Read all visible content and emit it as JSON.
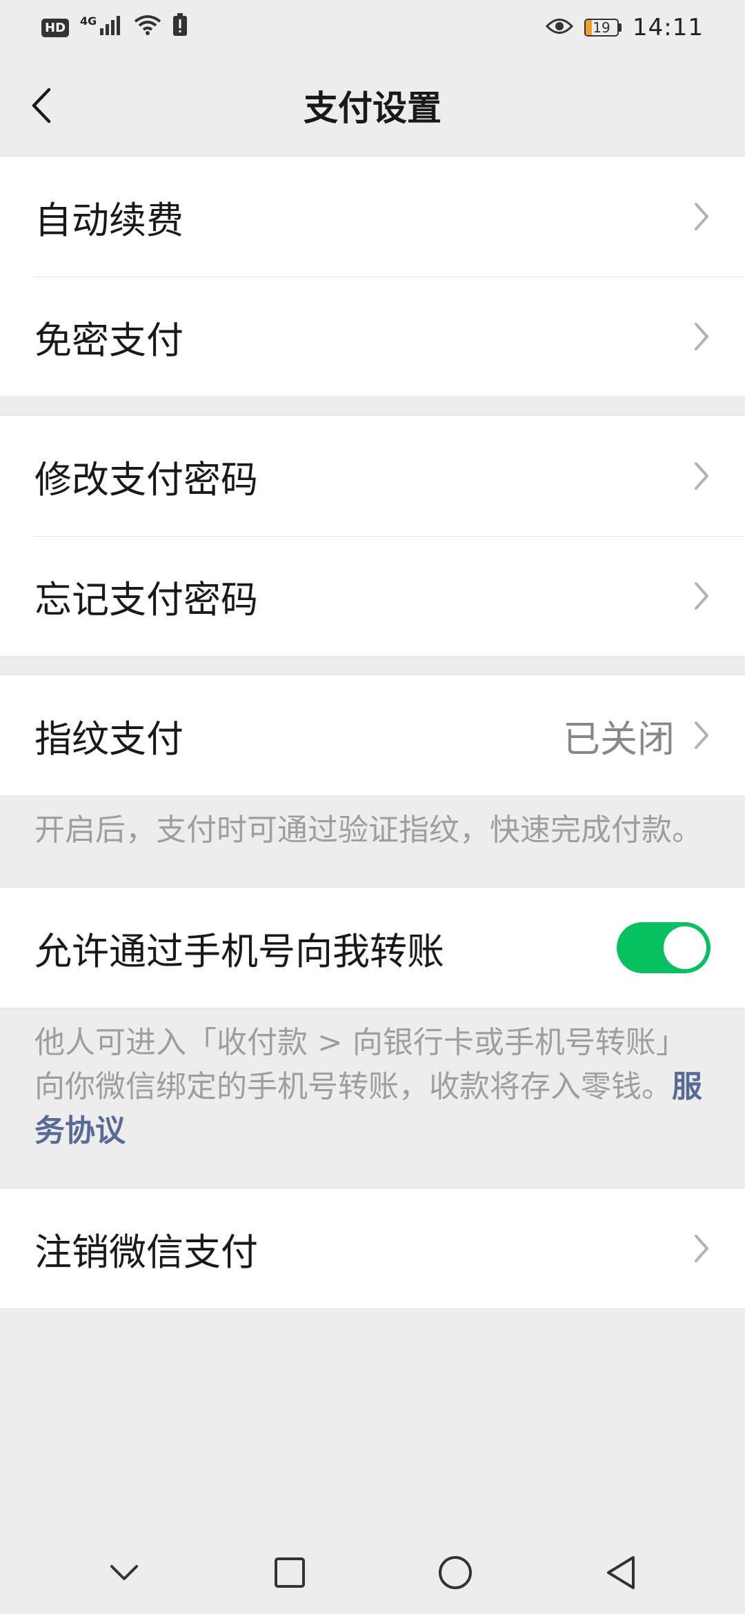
{
  "status_bar": {
    "hd": "HD",
    "network": "4G",
    "battery_level": "19",
    "battery_fraction": 0.19,
    "time": "14:11",
    "battery_color": "#f0a030"
  },
  "nav": {
    "title": "支付设置",
    "back_icon": "chevron-left-icon"
  },
  "groups": {
    "group1": {
      "auto_renew": "自动续费",
      "password_free": "免密支付"
    },
    "group2": {
      "change_password": "修改支付密码",
      "forgot_password": "忘记支付密码"
    },
    "group3": {
      "fingerprint": "指纹支付",
      "fingerprint_value": "已关闭",
      "fingerprint_note": "开启后，支付时可通过验证指纹，快速完成付款。"
    },
    "group4": {
      "phone_transfer": "允许通过手机号向我转账",
      "phone_transfer_enabled": true,
      "phone_transfer_note": "他人可进入「收付款 > 向银行卡或手机号转账」向你微信绑定的手机号转账，收款将存入零钱。",
      "service_agreement": "服务协议"
    },
    "group5": {
      "close_wechat_pay": "注销微信支付"
    }
  },
  "colors": {
    "accent_green": "#07c160",
    "link_blue": "#576b95",
    "background": "#ededed"
  },
  "system_nav": {
    "icons": [
      "chevron-down-icon",
      "square-icon",
      "circle-icon",
      "triangle-back-icon"
    ]
  }
}
